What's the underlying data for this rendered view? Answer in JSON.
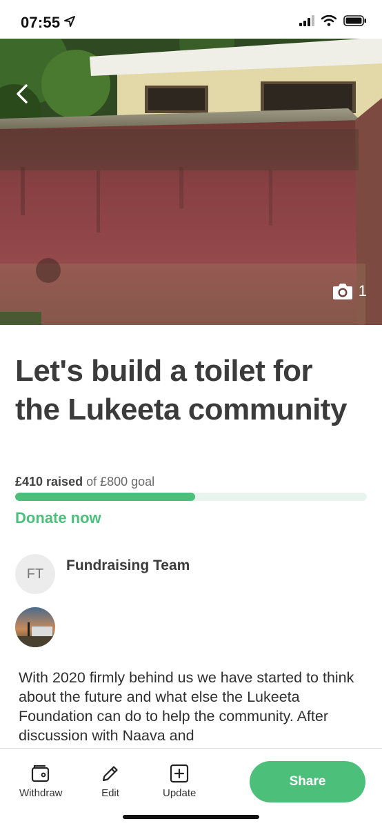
{
  "status": {
    "time": "07:55",
    "icons": [
      "location-arrow-icon",
      "signal-icon",
      "wifi-icon",
      "battery-icon"
    ]
  },
  "hero": {
    "photo_count": "1",
    "icons": [
      "back-chevron-icon",
      "camera-icon"
    ]
  },
  "campaign": {
    "title": "Let's build a toilet for the Lukeeta community",
    "raised_amount": "£410 raised",
    "goal_text": "of £800 goal",
    "progress_fraction": 0.5125,
    "donate_label": "Donate now"
  },
  "team": {
    "initials": "FT",
    "name": "Fundraising Team"
  },
  "story": {
    "text": "With 2020 firmly behind us we have started to think about the future and what else the Lukeeta Foundation can do to help the community. After discussion with Naava and"
  },
  "bottom_bar": {
    "withdraw_label": "Withdraw",
    "edit_label": "Edit",
    "update_label": "Update",
    "share_label": "Share"
  },
  "colors": {
    "accent": "#4cbf7b",
    "progress_track": "#e8f4ee",
    "title_text": "#3b3b3b"
  }
}
